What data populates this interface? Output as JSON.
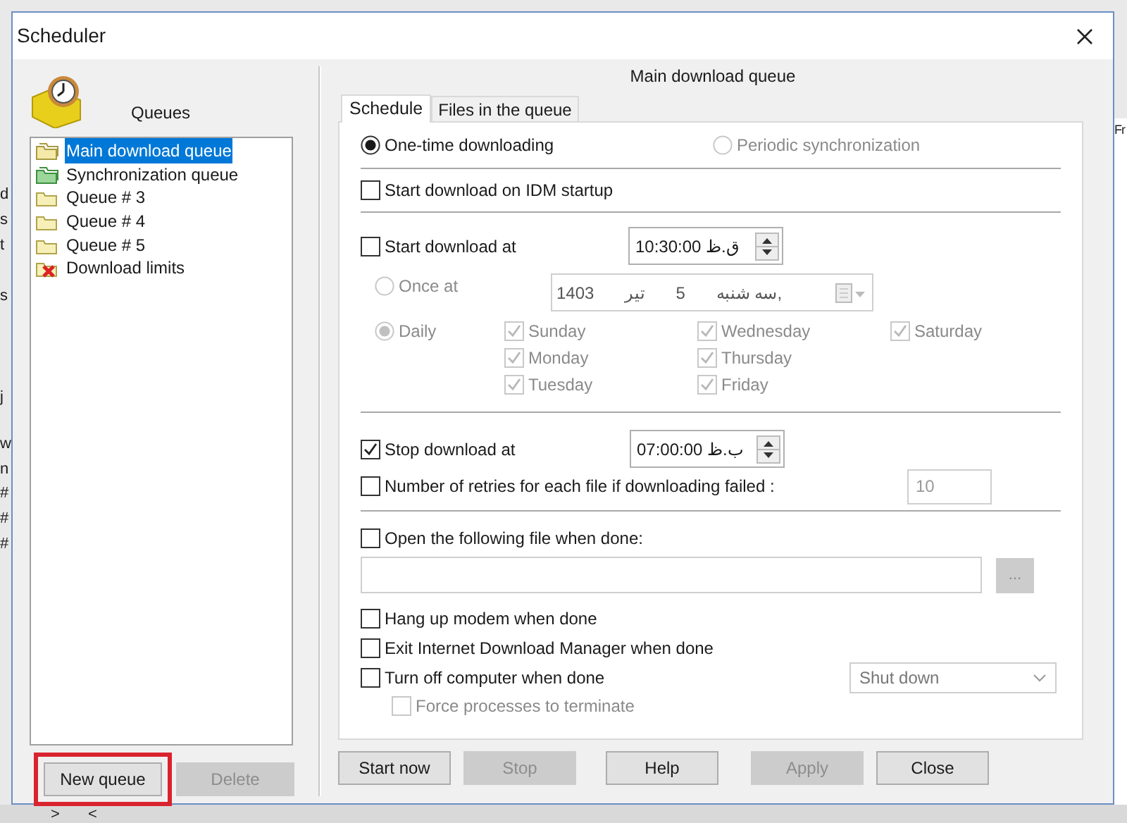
{
  "background": {
    "left_fragments": [
      "d",
      "s",
      "t",
      "s",
      "j",
      "w",
      "n",
      "#",
      "#",
      "#"
    ],
    "right_fragment": "Fr",
    "bottom_fragments": [
      ">",
      "<"
    ]
  },
  "window": {
    "title": "Scheduler"
  },
  "queues": {
    "label": "Queues",
    "items": [
      {
        "label": "Main download queue",
        "kind": "main",
        "selected": true
      },
      {
        "label": "Synchronization queue",
        "kind": "sync",
        "selected": false
      },
      {
        "label": "Queue # 3",
        "kind": "queue",
        "selected": false
      },
      {
        "label": "Queue # 4",
        "kind": "queue",
        "selected": false
      },
      {
        "label": "Queue # 5",
        "kind": "queue",
        "selected": false
      },
      {
        "label": "Download limits",
        "kind": "limits",
        "selected": false
      }
    ],
    "buttons": [
      {
        "label": "New queue",
        "disabled": false,
        "highlighted": true
      },
      {
        "label": "Delete",
        "disabled": true,
        "highlighted": false
      }
    ]
  },
  "header": "Main download queue",
  "tabs": [
    {
      "label": "Schedule",
      "selected": true
    },
    {
      "label": "Files in the queue",
      "selected": false
    }
  ],
  "schedule": {
    "mode_options": [
      {
        "label": "One-time downloading",
        "selected": true,
        "disabled": false
      },
      {
        "label": "Periodic synchronization",
        "selected": false,
        "disabled": true
      }
    ],
    "start_on_startup": {
      "label": "Start download on IDM startup",
      "checked": false
    },
    "start_at": {
      "label": "Start download at",
      "checked": false,
      "time": "10:30:00 ق.ظ"
    },
    "repeat_options": [
      {
        "label": "Once at",
        "selected": false,
        "disabled": true
      },
      {
        "label": "Daily",
        "selected": true,
        "disabled": true
      }
    ],
    "date": [
      "1403",
      "تیر",
      "5",
      "سه شنبه,"
    ],
    "days": [
      {
        "label": "Sunday",
        "checked": true
      },
      {
        "label": "Monday",
        "checked": true
      },
      {
        "label": "Tuesday",
        "checked": true
      },
      {
        "label": "Wednesday",
        "checked": true
      },
      {
        "label": "Thursday",
        "checked": true
      },
      {
        "label": "Friday",
        "checked": true
      },
      {
        "label": "Saturday",
        "checked": true
      }
    ],
    "days_disabled": true,
    "stop_at": {
      "label": "Stop download at",
      "checked": true,
      "time": "07:00:00 ب.ظ"
    },
    "retries": {
      "label": "Number of retries for each file if downloading failed :",
      "checked": false,
      "value": "10"
    },
    "open_file": {
      "label": "Open the following file when done:",
      "checked": false,
      "browse": "..."
    },
    "done_actions": [
      {
        "label": "Hang up modem when done",
        "checked": false
      },
      {
        "label": "Exit Internet Download Manager when done",
        "checked": false
      },
      {
        "label": "Turn off computer when done",
        "checked": false
      }
    ],
    "shutdown_mode": "Shut down",
    "force": {
      "label": "Force processes to terminate",
      "checked": false,
      "disabled": true
    }
  },
  "buttons": [
    {
      "label": "Start now",
      "disabled": false
    },
    {
      "label": "Stop",
      "disabled": true
    },
    {
      "label": "Help",
      "disabled": false
    },
    {
      "label": "Apply",
      "disabled": true
    },
    {
      "label": "Close",
      "disabled": false
    }
  ]
}
